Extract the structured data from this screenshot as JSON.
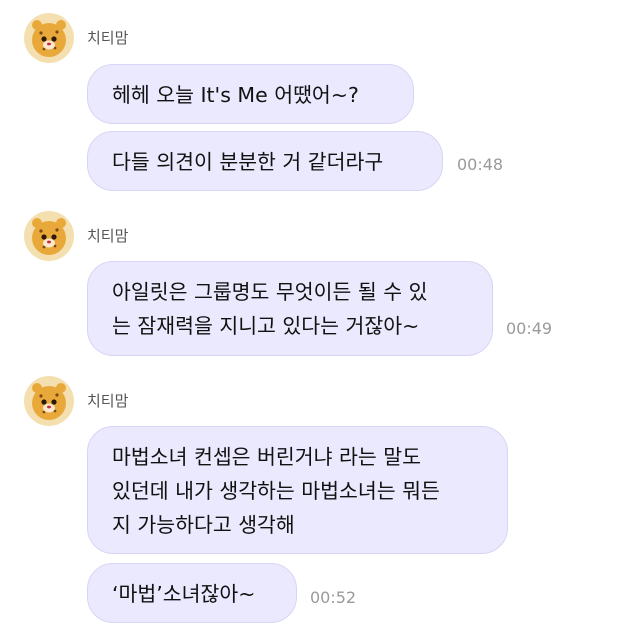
{
  "theme": {
    "bubble_color": "#ebe9fd",
    "bubble_border": "#d8d4f6",
    "time_color": "#9a9a9a"
  },
  "groups": [
    {
      "sender": "치티맘",
      "avatar_icon": "cheetah-avatar-icon",
      "messages": [
        {
          "lines": [
            "헤헤 오늘 It's Me 어땠어~?"
          ],
          "time": ""
        },
        {
          "lines": [
            "다들 의견이 분분한 거 같더라구"
          ],
          "time": "00:48"
        }
      ]
    },
    {
      "sender": "치티맘",
      "avatar_icon": "cheetah-avatar-icon",
      "messages": [
        {
          "lines": [
            "아일릿은 그룹명도 무엇이든 될 수 있",
            "는 잠재력을 지니고 있다는 거잖아~"
          ],
          "time": "00:49"
        }
      ]
    },
    {
      "sender": "치티맘",
      "avatar_icon": "cheetah-avatar-icon",
      "messages": [
        {
          "lines": [
            "마법소녀 컨셉은 버린거냐 라는 말도",
            "있던데 내가 생각하는 마법소녀는 뭐든",
            "지 가능하다고 생각해"
          ],
          "time": ""
        },
        {
          "lines": [
            "‘마법’소녀잖아~"
          ],
          "time": "00:52"
        }
      ]
    }
  ]
}
